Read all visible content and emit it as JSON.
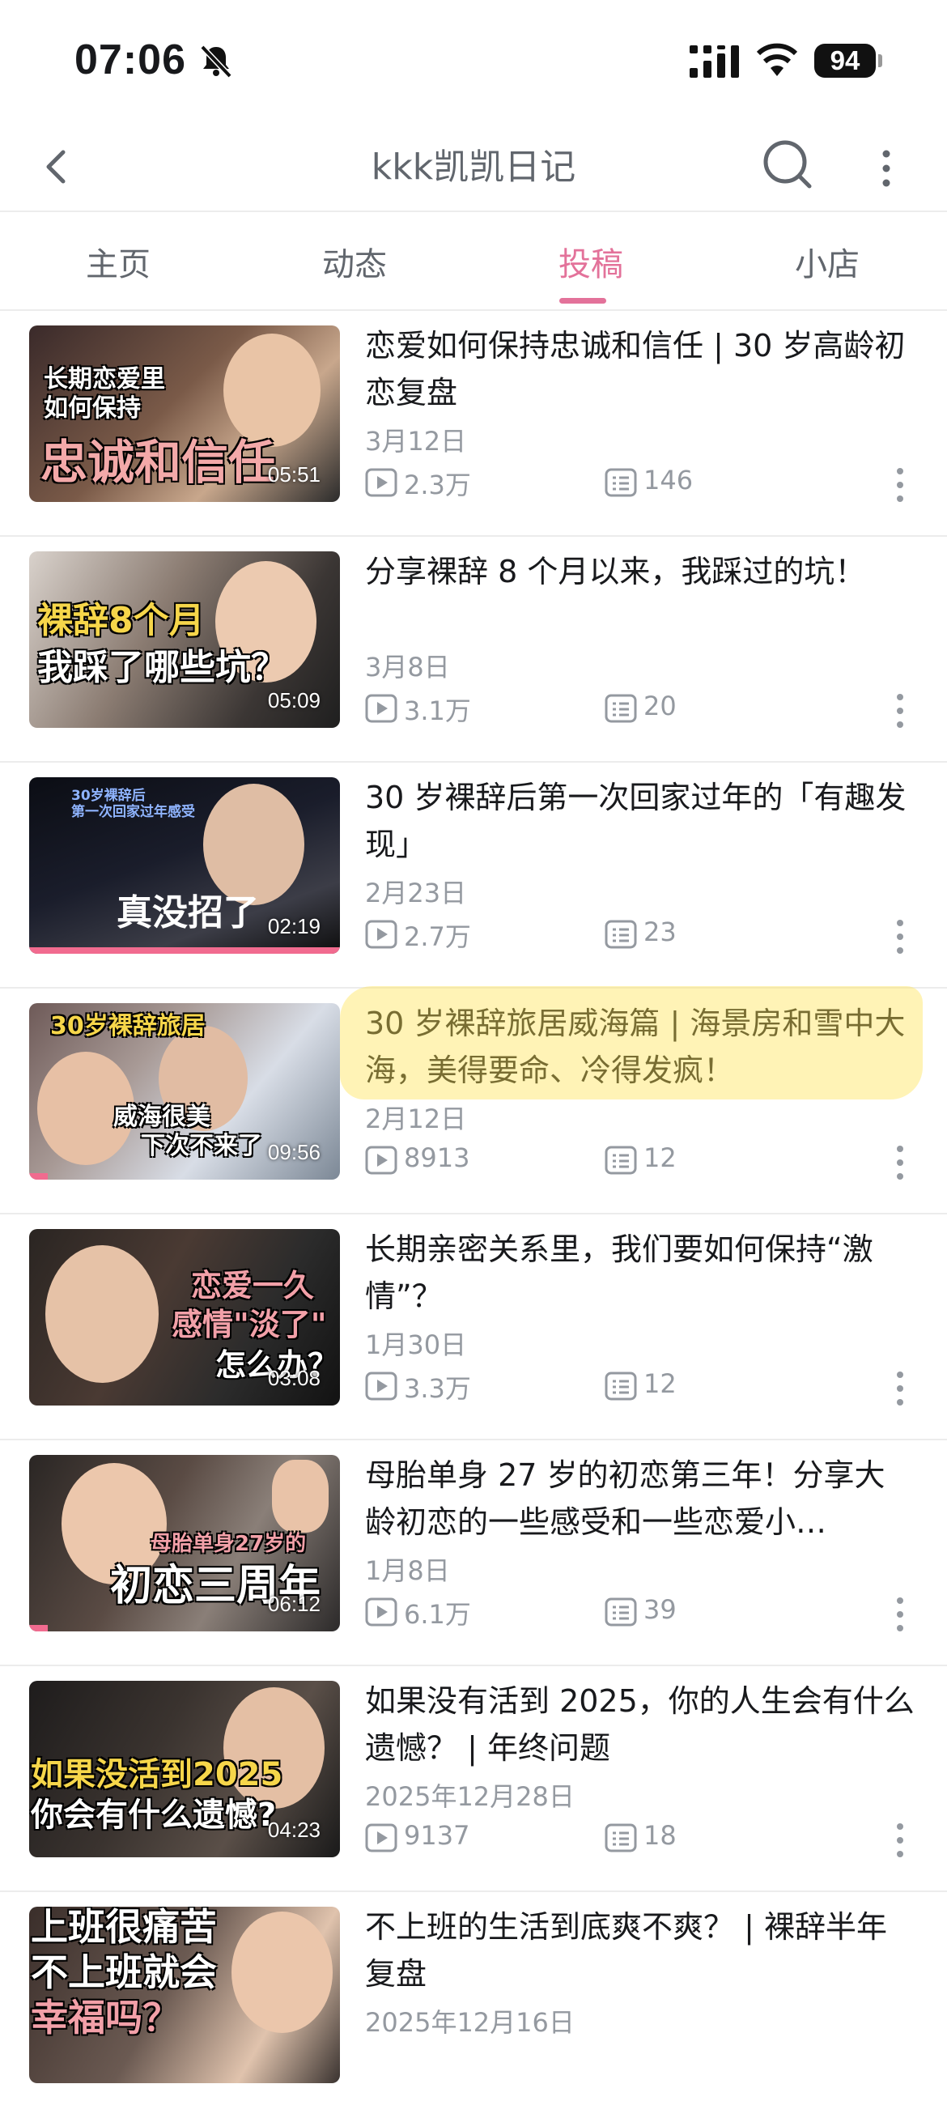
{
  "status_bar": {
    "time": "07:06",
    "battery": "94"
  },
  "nav": {
    "title": "kkk凯凯日记"
  },
  "tabs": [
    {
      "label": "主页"
    },
    {
      "label": "动态"
    },
    {
      "label": "投稿"
    },
    {
      "label": "小店"
    }
  ],
  "videos": [
    {
      "title": "恋爱如何保持忠诚和信任 | 30 岁高龄初恋复盘",
      "date": "3月12日",
      "views": "2.3万",
      "comments": "146",
      "duration": "05:51",
      "caption_lines": [
        "长期恋爱里",
        "如何保持",
        "忠诚和信任"
      ]
    },
    {
      "title": "分享裸辞 8 个月以来，我踩过的坑！",
      "date": "3月8日",
      "views": "3.1万",
      "comments": "20",
      "duration": "05:09",
      "caption_lines": [
        "裸辞8个月",
        "我踩了哪些坑？"
      ]
    },
    {
      "title": "30 岁裸辞后第一次回家过年的「有趣发现」",
      "date": "2月23日",
      "views": "2.7万",
      "comments": "23",
      "duration": "02:19",
      "caption_lines": [
        "30岁裸辞后",
        "第一次回家过年感受",
        "真没招了"
      ]
    },
    {
      "title": "30 岁裸辞旅居威海篇 | 海景房和雪中大海，美得要命、冷得发疯！",
      "date": "2月12日",
      "views": "8913",
      "comments": "12",
      "duration": "09:56",
      "caption_lines": [
        "30岁裸辞旅居",
        "威海很美",
        "下次不来了"
      ]
    },
    {
      "title": "长期亲密关系里，我们要如何保持“激情”？",
      "date": "1月30日",
      "views": "3.3万",
      "comments": "12",
      "duration": "03:08",
      "caption_lines": [
        "恋爱一久",
        "感情\"淡了\"",
        "怎么办？"
      ]
    },
    {
      "title": "母胎单身 27 岁的初恋第三年！分享大龄初恋的一些感受和一些恋爱小…",
      "date": "1月8日",
      "views": "6.1万",
      "comments": "39",
      "duration": "06:12",
      "caption_lines": [
        "母胎单身27岁的",
        "初恋三周年"
      ]
    },
    {
      "title": "如果没有活到 2025，你的人生会有什么遗憾？ | 年终问题",
      "date": "2025年12月28日",
      "views": "9137",
      "comments": "18",
      "duration": "04:23",
      "caption_lines": [
        "如果没活到2025",
        "你会有什么遗憾?"
      ]
    },
    {
      "title": "不上班的生活到底爽不爽？ | 裸辞半年复盘",
      "date": "2025年12月16日",
      "views": "",
      "comments": "",
      "duration": "",
      "caption_lines": [
        "上班很痛苦",
        "不上班就会",
        "幸福吗？"
      ]
    }
  ],
  "colors": {
    "accent": "#e3729a",
    "progress": "#f16b8f",
    "muted": "#9499a0"
  }
}
